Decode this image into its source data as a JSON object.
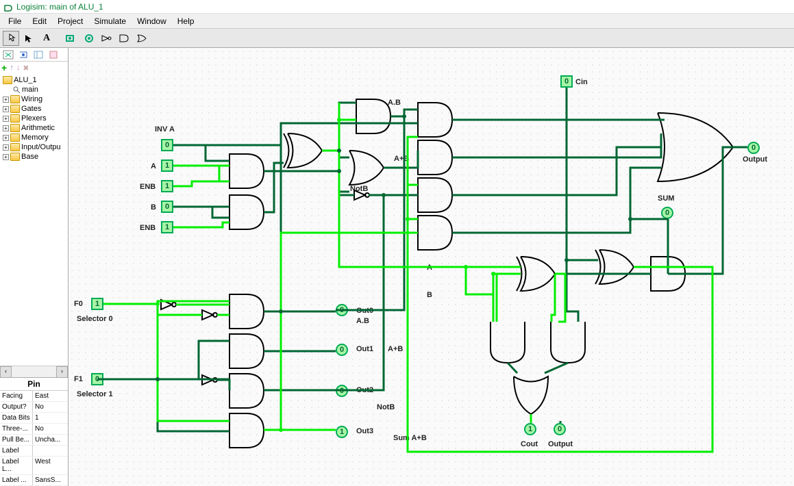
{
  "title": "Logisim: main of ALU_1",
  "menu": {
    "file": "File",
    "edit": "Edit",
    "project": "Project",
    "simulate": "Simulate",
    "window": "Window",
    "help": "Help"
  },
  "tree": {
    "root": "ALU_1",
    "main": "main",
    "items": [
      "Wiring",
      "Gates",
      "Plexers",
      "Arithmetic",
      "Memory",
      "Input/Outpu",
      "Base"
    ]
  },
  "props": {
    "header": "Pin",
    "rows": [
      {
        "k": "Facing",
        "v": "East"
      },
      {
        "k": "Output?",
        "v": "No"
      },
      {
        "k": "Data Bits",
        "v": "1"
      },
      {
        "k": "Three-...",
        "v": "No"
      },
      {
        "k": "Pull Be...",
        "v": "Uncha..."
      },
      {
        "k": "Label",
        "v": ""
      },
      {
        "k": "Label L...",
        "v": "West"
      },
      {
        "k": "Label ...",
        "v": "SansS..."
      }
    ]
  },
  "labels": {
    "inva": "INV A",
    "a": "A",
    "enb1": "ENB",
    "b": "B",
    "enb2": "ENB",
    "f0": "F0",
    "sel0": "Selector 0",
    "f1": "F1",
    "sel1": "Selector 1",
    "cin": "Cin",
    "ab": "A.B",
    "aplusb": "A+B",
    "notb": "NotB",
    "alabel": "A",
    "blabel": "B",
    "out0": "Out0",
    "out0s": "A.B",
    "out1": "Out1",
    "out1s": "A+B",
    "out2": "Out2",
    "out2s": "NotB",
    "out3": "Out3",
    "out3s": "Sum A+B",
    "sum": "SUM",
    "output": "Output",
    "cout": "Cout",
    "coutout": "Output"
  },
  "pins": {
    "inva": "0",
    "a": "1",
    "enb1": "1",
    "b": "0",
    "enb2": "1",
    "f0": "1",
    "f1": "0",
    "cin": "0",
    "out0": "0",
    "out1": "0",
    "out2": "0",
    "out3": "1",
    "sum": "0",
    "output": "0",
    "cout": "1",
    "coutout": "0"
  }
}
